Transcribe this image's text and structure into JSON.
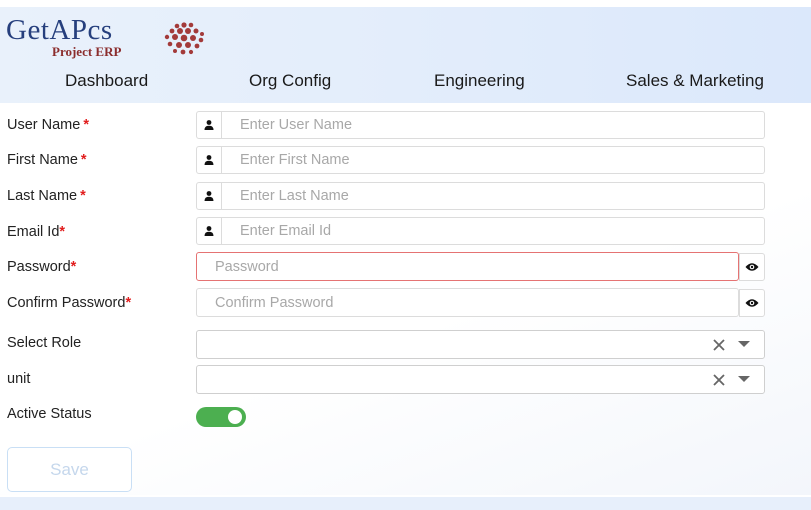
{
  "brand": {
    "name": "GetAPcs",
    "subtitle": "Project ERP"
  },
  "nav": {
    "items": [
      {
        "label": "Dashboard"
      },
      {
        "label": "Org Config"
      },
      {
        "label": "Engineering"
      },
      {
        "label": "Sales & Marketing"
      }
    ]
  },
  "form": {
    "user_name": {
      "label": "User Name",
      "required": "*",
      "placeholder": "Enter User Name",
      "icon": "user-icon"
    },
    "first_name": {
      "label": "First Name",
      "required": "*",
      "placeholder": "Enter First Name",
      "icon": "user-icon"
    },
    "last_name": {
      "label": "Last Name",
      "required": "*",
      "placeholder": "Enter Last Name",
      "icon": "user-icon"
    },
    "email": {
      "label": "Email Id",
      "required": "*",
      "placeholder": "Enter Email Id",
      "icon": "user-icon"
    },
    "password": {
      "label": "Password",
      "required": "*",
      "placeholder": "Password",
      "icon": "eye-icon"
    },
    "confirm_password": {
      "label": "Confirm Password",
      "required": "*",
      "placeholder": "Confirm Password",
      "icon": "eye-icon"
    },
    "select_role": {
      "label": "Select Role",
      "value": ""
    },
    "unit": {
      "label": "unit",
      "value": ""
    },
    "active_status": {
      "label": "Active Status",
      "on": true
    },
    "save_label": "Save"
  },
  "colors": {
    "required": "#e11d1d",
    "toggle_on": "#4caf50",
    "error_border": "#e57373",
    "logo_blue": "#263f7d",
    "logo_red": "#8b2d2d"
  }
}
